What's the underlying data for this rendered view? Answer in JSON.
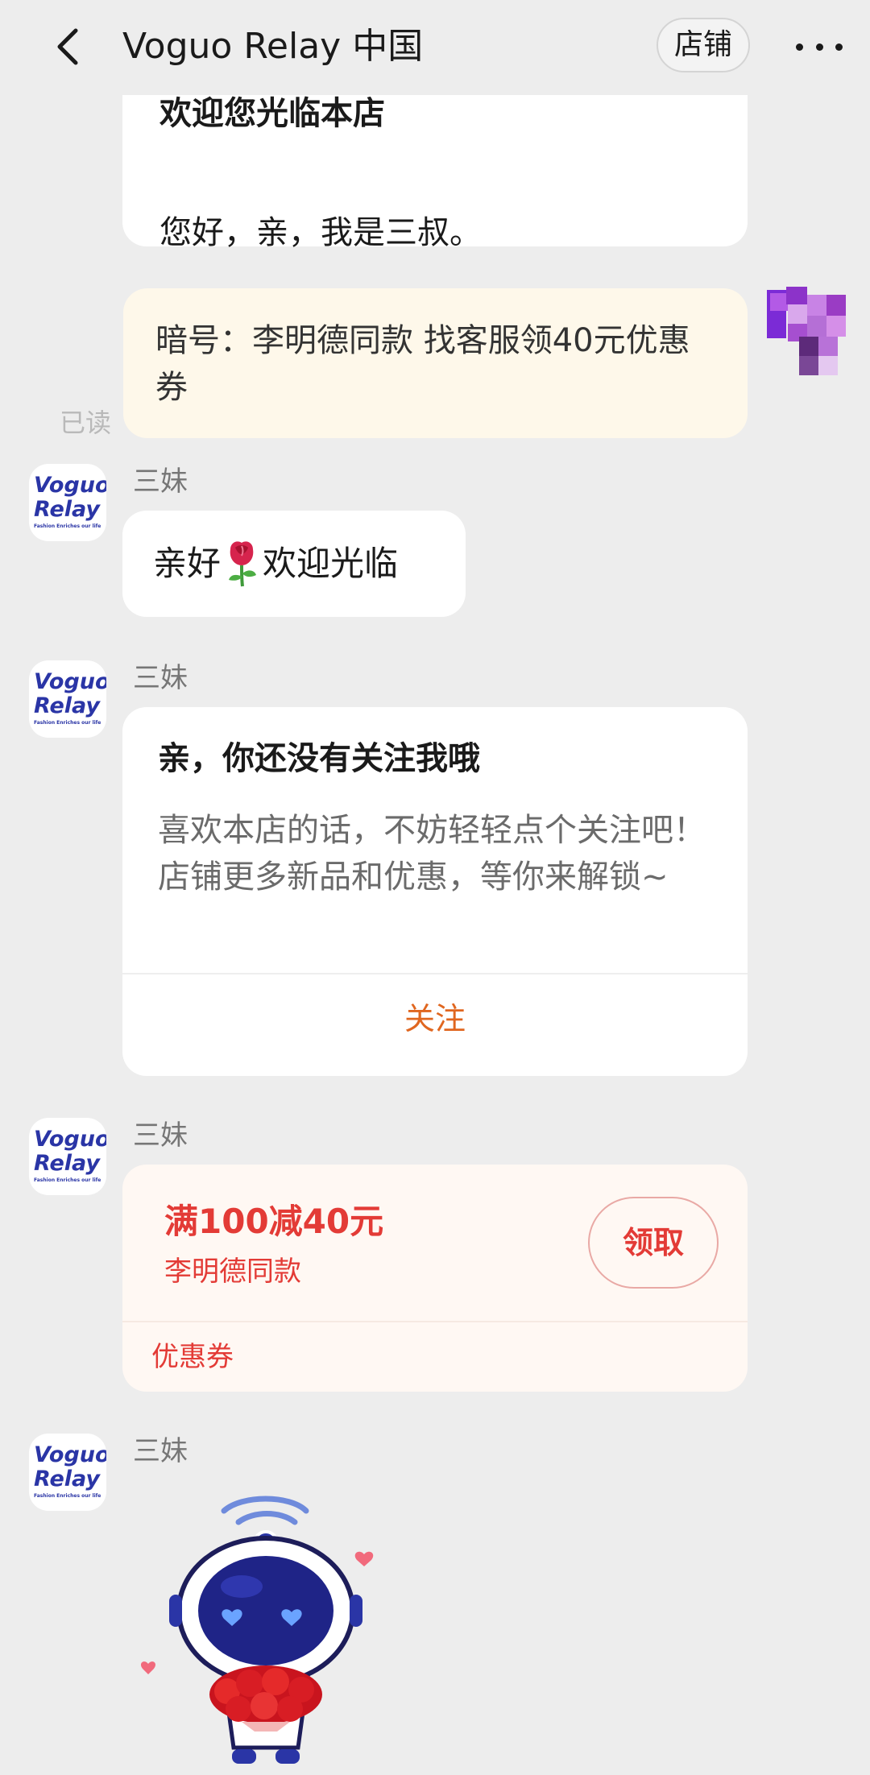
{
  "header": {
    "title": "Voguo Relay 中国",
    "shop_label": "店铺"
  },
  "welcome_card": {
    "title": "欢迎您光临本店",
    "text": "您好，亲，我是三叔。"
  },
  "my_message": {
    "text": "暗号：李明德同款 找客服领40元优惠券",
    "read_status": "已读"
  },
  "shop_avatar": {
    "logo_line1": "Voguo",
    "logo_line2": "Relay",
    "tagline": "Fashion Enriches our life"
  },
  "messages": [
    {
      "sender": "三妹",
      "text_before": "亲好",
      "text_after": "欢迎光临"
    },
    {
      "sender": "三妹",
      "card_title": "亲，你还没有关注我哦",
      "card_body": "喜欢本店的话，不妨轻轻点个关注吧！店铺更多新品和优惠，等你来解锁~",
      "card_button": "关注"
    },
    {
      "sender": "三妹",
      "coupon_amount": "满100减40元",
      "coupon_desc": "李明德同款",
      "coupon_button": "领取",
      "coupon_type": "优惠券"
    },
    {
      "sender": "三妹"
    }
  ],
  "colors": {
    "background": "#ededed",
    "accent_orange": "#e0661f",
    "coupon_red": "#e33b36",
    "my_bubble": "#fef8ea",
    "logo_blue": "#2a35a6"
  }
}
